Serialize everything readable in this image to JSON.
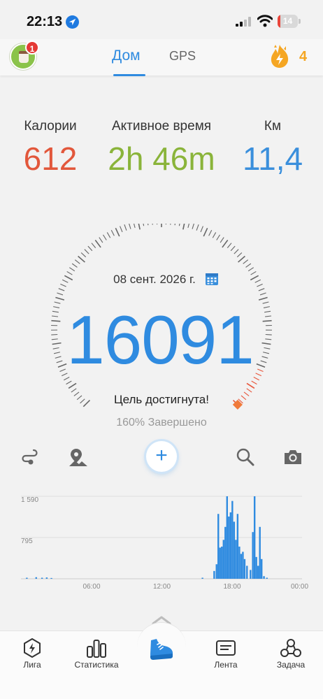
{
  "status_bar": {
    "time": "22:13",
    "battery": "14",
    "battery_level": 0.14
  },
  "header": {
    "notification_count": "1",
    "tabs": [
      {
        "label": "Дом",
        "active": true
      },
      {
        "label": "GPS",
        "active": false
      }
    ],
    "energy_count": "4"
  },
  "stats": {
    "calories": {
      "label": "Калории",
      "value": "612",
      "color": "#e2573b"
    },
    "active_time": {
      "label": "Активное время",
      "value": "2h 46m",
      "color": "#8ab43a"
    },
    "distance": {
      "label": "Км",
      "value": "11,4",
      "color": "#3a8fdc"
    }
  },
  "gauge": {
    "date": "08 сент. 2026 г.",
    "steps": "16091",
    "goal_text": "Цель достигнута!",
    "percent_text": "160% Завершено",
    "progress": 1.6
  },
  "toolbar": {
    "icons": [
      "route-icon",
      "map-pin-icon",
      "add-button",
      "search-icon",
      "camera-icon"
    ]
  },
  "chart_data": {
    "type": "bar",
    "ytick_labels": [
      "1 590",
      "795"
    ],
    "xtick_labels": [
      "06:00",
      "12:00",
      "18:00",
      "00:00"
    ],
    "ylim": [
      0,
      1590
    ],
    "bars": [
      {
        "x": 0.5,
        "y": 20
      },
      {
        "x": 1.3,
        "y": 30
      },
      {
        "x": 1.8,
        "y": 20
      },
      {
        "x": 2.2,
        "y": 25
      },
      {
        "x": 2.6,
        "y": 15
      },
      {
        "x": 15.5,
        "y": 20
      },
      {
        "x": 16.5,
        "y": 150
      },
      {
        "x": 16.7,
        "y": 280
      },
      {
        "x": 16.85,
        "y": 1250
      },
      {
        "x": 17.0,
        "y": 600
      },
      {
        "x": 17.15,
        "y": 620
      },
      {
        "x": 17.3,
        "y": 750
      },
      {
        "x": 17.45,
        "y": 1000
      },
      {
        "x": 17.6,
        "y": 1590
      },
      {
        "x": 17.75,
        "y": 1200
      },
      {
        "x": 17.9,
        "y": 1280
      },
      {
        "x": 18.05,
        "y": 1500
      },
      {
        "x": 18.2,
        "y": 1100
      },
      {
        "x": 18.35,
        "y": 750
      },
      {
        "x": 18.5,
        "y": 1250
      },
      {
        "x": 18.65,
        "y": 620
      },
      {
        "x": 18.8,
        "y": 480
      },
      {
        "x": 18.95,
        "y": 520
      },
      {
        "x": 19.1,
        "y": 380
      },
      {
        "x": 19.3,
        "y": 250
      },
      {
        "x": 19.6,
        "y": 170
      },
      {
        "x": 19.8,
        "y": 900
      },
      {
        "x": 19.95,
        "y": 1600
      },
      {
        "x": 20.1,
        "y": 420
      },
      {
        "x": 20.25,
        "y": 250
      },
      {
        "x": 20.4,
        "y": 1000
      },
      {
        "x": 20.55,
        "y": 380
      },
      {
        "x": 20.75,
        "y": 50
      },
      {
        "x": 21.0,
        "y": 20
      }
    ]
  },
  "bottom_nav": {
    "items": [
      {
        "label": "Лига",
        "icon": "league-icon"
      },
      {
        "label": "Статистика",
        "icon": "stats-icon"
      },
      {
        "label": "",
        "icon": "sneaker-icon"
      },
      {
        "label": "Лента",
        "icon": "feed-icon"
      },
      {
        "label": "Задача",
        "icon": "task-icon"
      }
    ]
  },
  "colors": {
    "accent": "#2f8be0",
    "orange": "#f5a623",
    "red": "#e53935"
  }
}
